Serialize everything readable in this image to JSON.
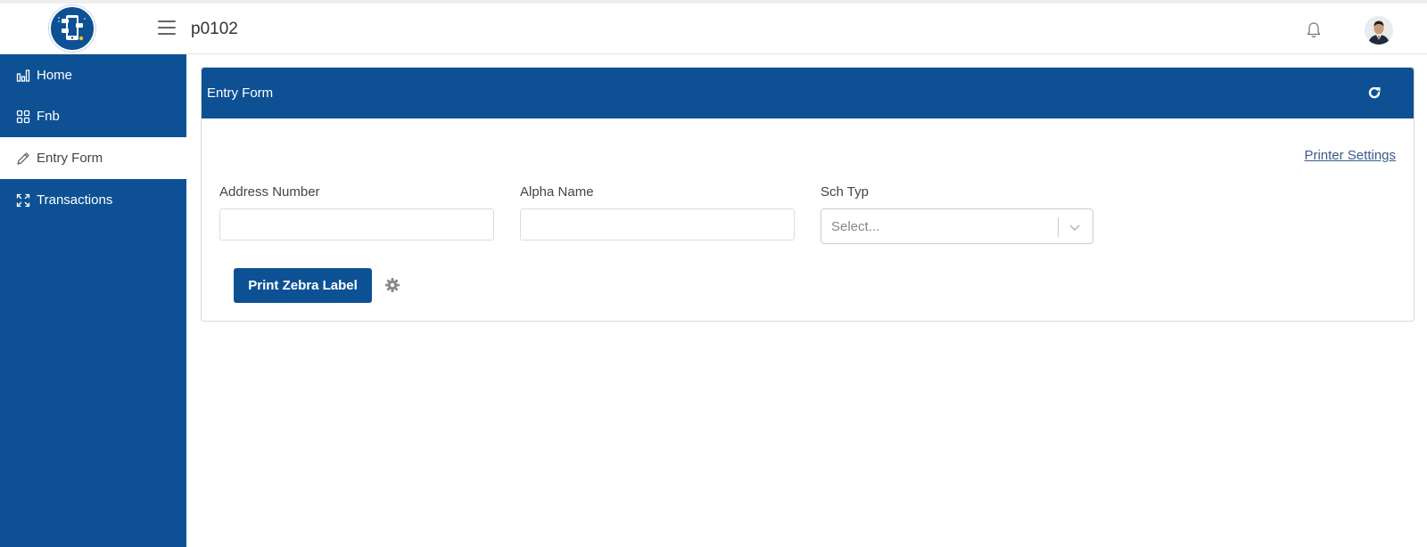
{
  "header": {
    "app_title": "p0102",
    "logo_icon": "mobile-app-logo-icon",
    "menu_icon": "hamburger-icon",
    "notification_icon": "bell-icon",
    "avatar_icon": "user-avatar-icon"
  },
  "sidebar": {
    "items": [
      {
        "label": "Home",
        "icon": "bar-chart-icon",
        "active": false
      },
      {
        "label": "Fnb",
        "icon": "grid-icon",
        "active": false
      },
      {
        "label": "Entry Form",
        "icon": "pencil-icon",
        "active": true
      },
      {
        "label": "Transactions",
        "icon": "expand-arrows-icon",
        "active": false
      }
    ]
  },
  "card": {
    "title": "Entry Form",
    "refresh_icon": "refresh-icon",
    "printer_settings_link": "Printer Settings",
    "fields": {
      "address_number": {
        "label": "Address Number",
        "value": ""
      },
      "alpha_name": {
        "label": "Alpha Name",
        "value": ""
      },
      "sch_typ": {
        "label": "Sch Typ",
        "placeholder": "Select..."
      }
    },
    "print_button": "Print Zebra Label",
    "settings_icon": "gear-icon"
  },
  "colors": {
    "primary": "#0d5194",
    "sidebar_active_bg": "#ffffff",
    "link": "#3a5a8c"
  }
}
